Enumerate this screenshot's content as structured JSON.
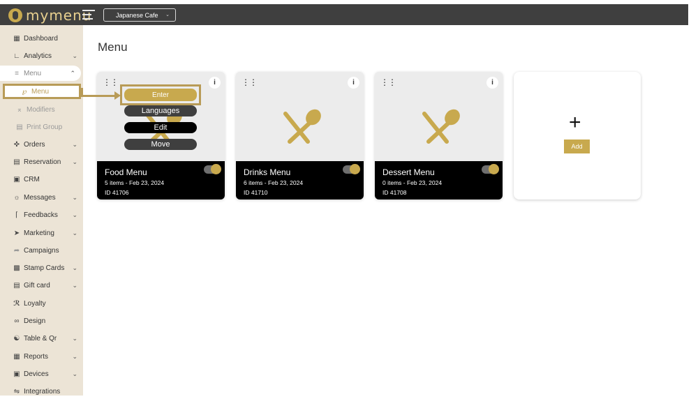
{
  "app": {
    "logo_text": "mymenu",
    "store": "Japanese Cafe"
  },
  "colors": {
    "accent": "#c8a94e",
    "topbar": "#3f3f3f",
    "sidebar": "#ece4d6",
    "highlight": "#b89b57"
  },
  "sidebar": {
    "items": [
      {
        "label": "Dashboard",
        "icon": "grid-icon"
      },
      {
        "label": "Analytics",
        "icon": "chart-icon"
      },
      {
        "label": "Menu",
        "icon": "list-icon"
      },
      {
        "label": "Menu",
        "icon": "utensils-icon"
      },
      {
        "label": "Modifiers",
        "icon": "expand-icon"
      },
      {
        "label": "Print Group",
        "icon": "print-group-icon"
      },
      {
        "label": "Orders",
        "icon": "orders-icon"
      },
      {
        "label": "Reservation",
        "icon": "reservation-icon"
      },
      {
        "label": "CRM",
        "icon": "crm-icon"
      },
      {
        "label": "Messages",
        "icon": "messages-icon"
      },
      {
        "label": "Feedbacks",
        "icon": "feedback-icon"
      },
      {
        "label": "Marketing",
        "icon": "megaphone-icon"
      },
      {
        "label": "Campaigns",
        "icon": "campaign-icon"
      },
      {
        "label": "Stamp Cards",
        "icon": "stamp-card-icon"
      },
      {
        "label": "Gift card",
        "icon": "gift-icon"
      },
      {
        "label": "Loyalty",
        "icon": "loyalty-icon"
      },
      {
        "label": "Design",
        "icon": "design-icon"
      },
      {
        "label": "Table & Qr",
        "icon": "table-icon"
      },
      {
        "label": "Reports",
        "icon": "report-icon"
      },
      {
        "label": "Devices",
        "icon": "device-icon"
      },
      {
        "label": "Integrations",
        "icon": "integrations-icon"
      }
    ]
  },
  "main": {
    "title": "Menu",
    "menus": [
      {
        "name": "Food Menu",
        "meta": "5 items - Feb 23, 2024",
        "id": "ID 41706",
        "enabled": true
      },
      {
        "name": "Drinks Menu",
        "meta": "6 items - Feb 23, 2024",
        "id": "ID 41710",
        "enabled": true
      },
      {
        "name": "Dessert Menu",
        "meta": "0 items - Feb 23, 2024",
        "id": "ID 41708",
        "enabled": true
      }
    ],
    "actions": {
      "enter": "Enter",
      "languages": "Languages",
      "edit": "Edit",
      "move": "Move"
    },
    "add_card": {
      "plus": "+",
      "label": "Add"
    }
  }
}
